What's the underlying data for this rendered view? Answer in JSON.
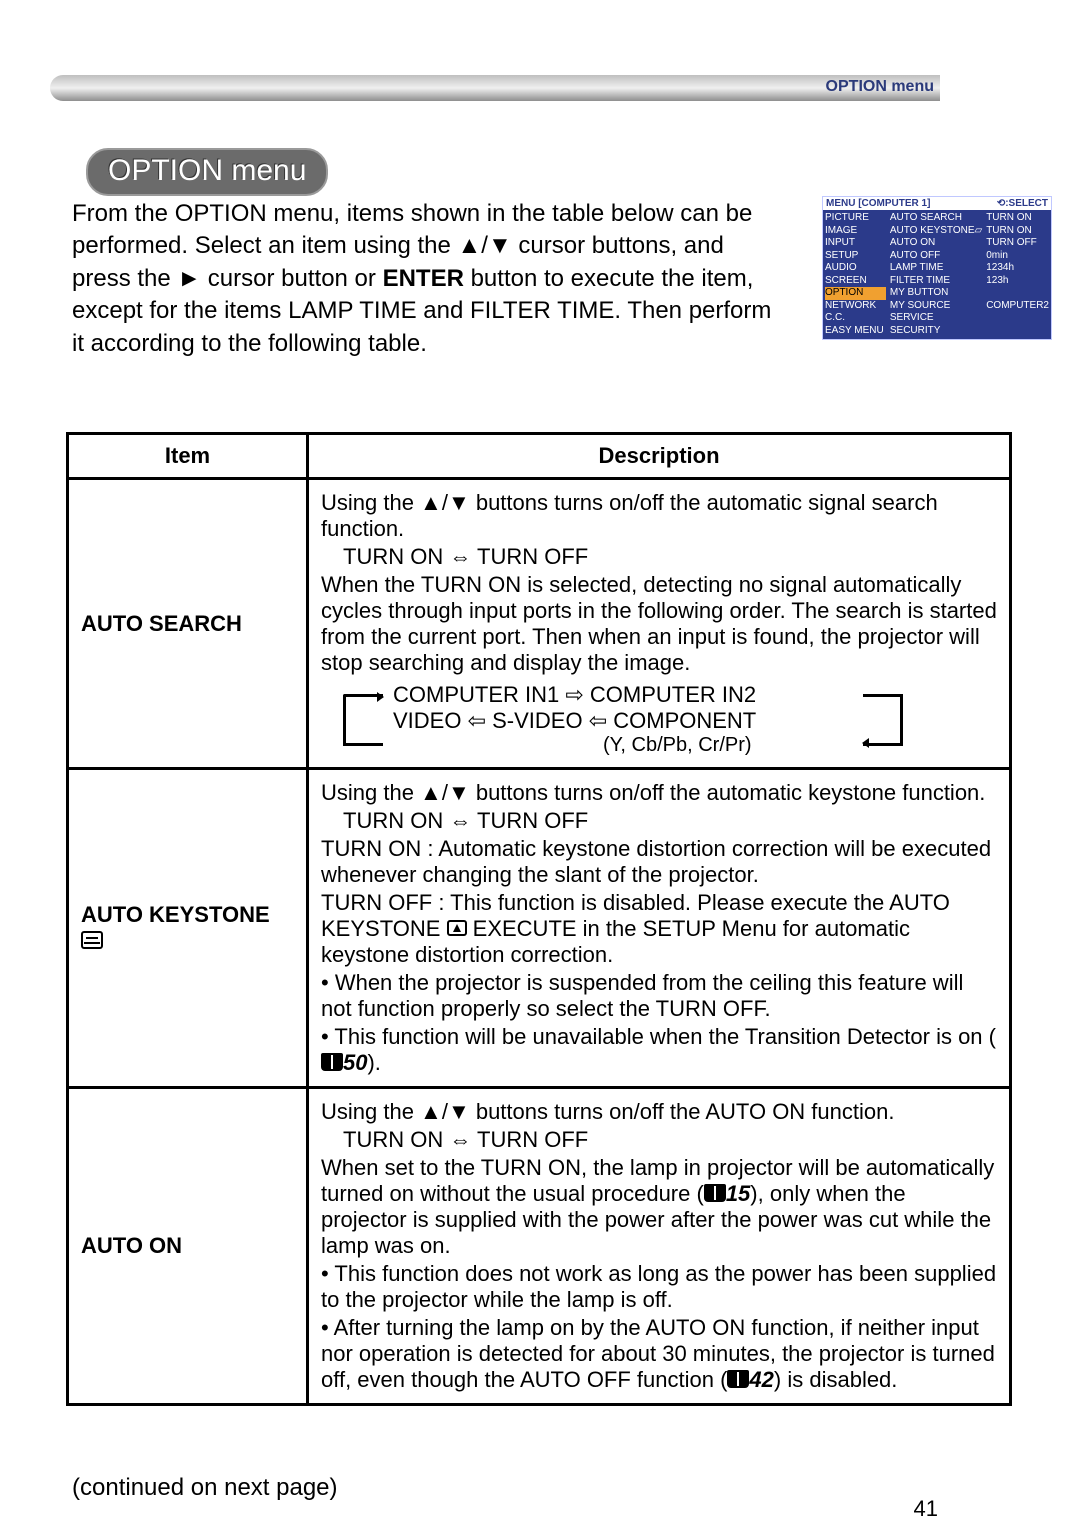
{
  "header": {
    "label": "OPTION menu"
  },
  "pill": "OPTION menu",
  "intro_html": "From the OPTION menu, items shown in the table below can be performed.\nSelect an item using the ▲/▼ cursor buttons, and press the ► cursor button or <b>ENTER</b> button to execute the item, except for the items LAMP TIME and FILTER TIME. Then perform it according to the following table.",
  "menu_shot": {
    "head_left": "MENU [COMPUTER 1]",
    "head_right": "⟲:SELECT",
    "col1": [
      "PICTURE",
      "IMAGE",
      "INPUT",
      "SETUP",
      "AUDIO",
      "SCREEN",
      "OPTION",
      "NETWORK",
      "C.C.",
      "EASY MENU"
    ],
    "col2": [
      "AUTO SEARCH",
      "AUTO KEYSTONE▱",
      "AUTO ON",
      "AUTO OFF",
      "LAMP TIME",
      "FILTER TIME",
      "MY BUTTON",
      "MY SOURCE",
      "SERVICE",
      "SECURITY"
    ],
    "col3": [
      "TURN ON",
      "TURN ON",
      "TURN OFF",
      "0min",
      "1234h",
      "123h",
      "",
      "COMPUTER2",
      "",
      ""
    ],
    "selected_index": 6
  },
  "table": {
    "head_item": "Item",
    "head_desc": "Description",
    "rows": [
      {
        "item": "AUTO SEARCH",
        "p1": "Using the ▲/▼ buttons turns on/off the automatic signal search function.",
        "toggle": "TURN ON ⇔ TURN OFF",
        "p2": "When the TURN ON is selected, detecting no signal automatically cycles through input ports in the following order. The search is started from the current port. Then when an input is found, the projector will stop searching and display the image.",
        "flow_top": "COMPUTER IN1 ⇨ COMPUTER IN2",
        "flow_bot": "VIDEO ⇦ S-VIDEO ⇦ COMPONENT",
        "flow_sub": "(Y, Cb/Pb, Cr/Pr)"
      },
      {
        "item": "AUTO KEYSTONE",
        "p1": "Using the ▲/▼ buttons turns on/off the automatic keystone function.",
        "toggle": "TURN ON ⇔ TURN OFF",
        "p2": "TURN ON : Automatic keystone distortion correction will be executed whenever changing the slant of the projector.",
        "p3a": "TURN OFF : This function is disabled. Please execute the AUTO KEYSTONE ",
        "p3b": " EXECUTE in the SETUP Menu for automatic keystone distortion correction.",
        "p4": "• When the projector is suspended from the ceiling this feature will not function properly so select the TURN OFF.",
        "p5a": "• This function will be unavailable when the Transition Detector is on (",
        "p5ref": "50",
        "p5b": ")."
      },
      {
        "item": "AUTO ON",
        "p1": "Using the ▲/▼ buttons turns on/off the AUTO ON function.",
        "toggle": "TURN ON ⇔ TURN OFF",
        "p2a": "When set to the TURN ON, the lamp in projector will be automatically turned on without the usual procedure (",
        "p2ref": "15",
        "p2b": "), only when the projector is supplied with the power after the power was cut while the lamp was on.",
        "p3": "• This function does not work as long as the power has been supplied to the projector while the lamp is off.",
        "p4a": "• After turning the lamp on by the AUTO ON function, if neither input nor operation is detected for about 30 minutes, the projector is turned off, even though the AUTO OFF function (",
        "p4ref": "42",
        "p4b": ") is disabled."
      }
    ]
  },
  "continued": "(continued on next page)",
  "page_number": "41"
}
